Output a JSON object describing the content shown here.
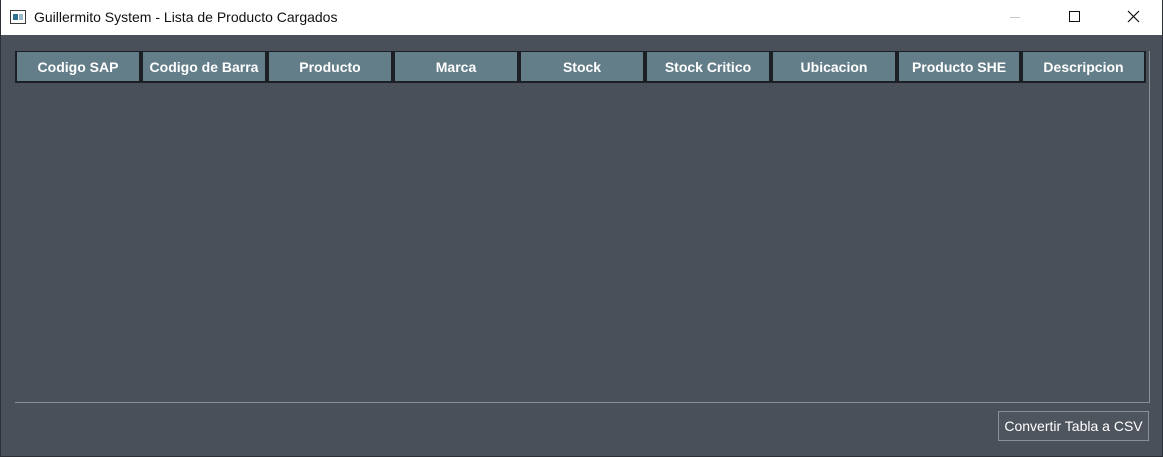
{
  "window": {
    "title": "Guillermito System - Lista de Producto Cargados"
  },
  "titlebar": {
    "icons": [
      "app-icon",
      "minimize-icon",
      "maximize-icon",
      "close-icon"
    ]
  },
  "table": {
    "columns": [
      "Codigo SAP",
      "Codigo de Barra",
      "Producto",
      "Marca",
      "Stock",
      "Stock Critico",
      "Ubicacion",
      "Producto SHE",
      "Descripcion"
    ],
    "rows": []
  },
  "actions": {
    "export_label": "Convertir Tabla a CSV"
  },
  "colors": {
    "background": "#4a505a",
    "header": "#647e89",
    "header_text": "#ffffff"
  }
}
